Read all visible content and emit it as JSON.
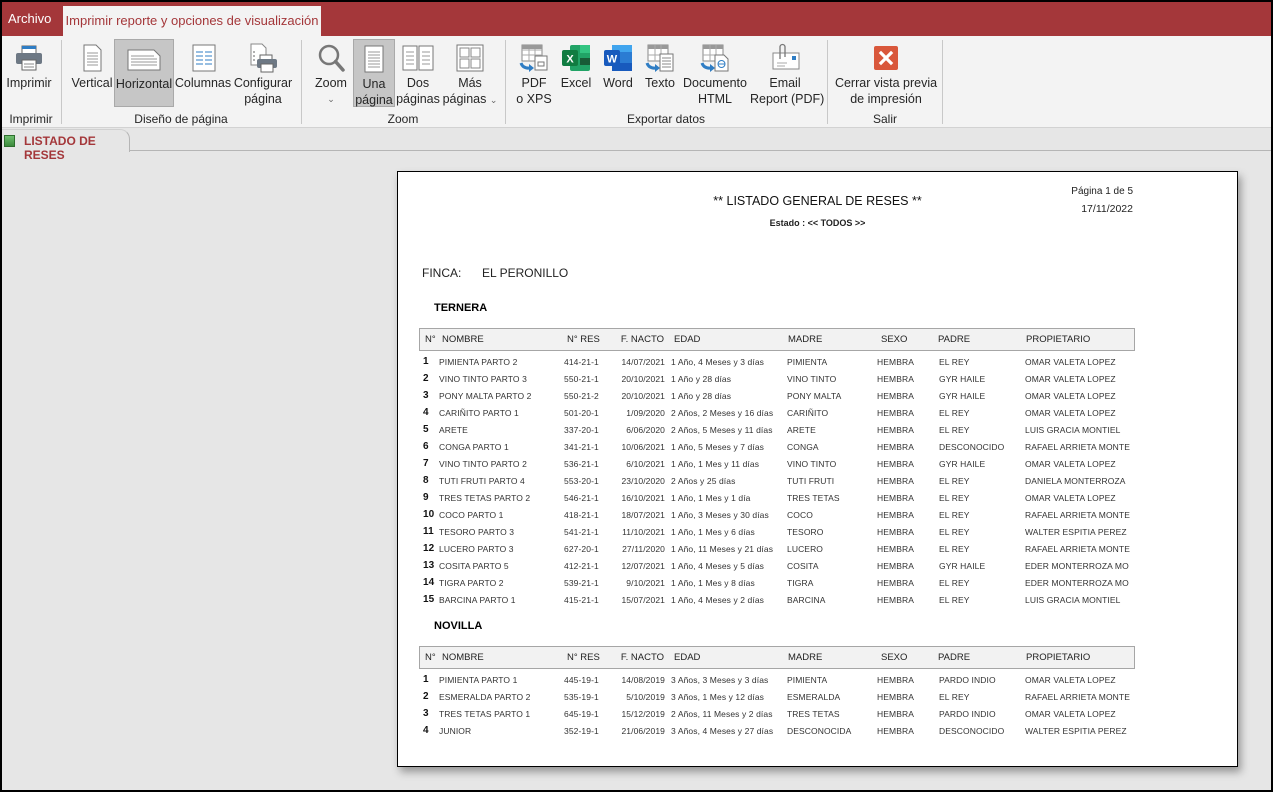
{
  "tabs": {
    "file": "Archivo",
    "active": "Imprimir reporte y opciones de visualización"
  },
  "ribbon": {
    "groups": {
      "imprimir": "Imprimir",
      "diseno": "Diseño de página",
      "zoom": "Zoom",
      "exportar": "Exportar datos",
      "salir": "Salir"
    },
    "buttons": {
      "imprimir": "Imprimir",
      "vertical": "Vertical",
      "horizontal": "Horizontal",
      "columnas": "Columnas",
      "configurar_1": "Configurar",
      "configurar_2": "página",
      "zoom": "Zoom",
      "una_1": "Una",
      "una_2": "página",
      "dos_1": "Dos",
      "dos_2": "páginas",
      "mas_1": "Más",
      "mas_2": "páginas",
      "pdf_1": "PDF",
      "pdf_2": "o XPS",
      "excel": "Excel",
      "word": "Word",
      "texto": "Texto",
      "html_1": "Documento",
      "html_2": "HTML",
      "email_1": "Email",
      "email_2": "Report (PDF)",
      "cerrar_1": "Cerrar vista previa",
      "cerrar_2": "de impresión"
    },
    "selected": [
      "horizontal",
      "una_pagina"
    ]
  },
  "document_tab": "LISTADO DE RESES",
  "report": {
    "title": "** LISTADO GENERAL DE RESES **",
    "estado": "Estado : << TODOS >>",
    "page_info": "Página 1 de 5",
    "date": "17/11/2022",
    "finca_label": "FINCA:",
    "finca_value": "EL PERONILLO",
    "columns": [
      "N°",
      "NOMBRE",
      "N° RES",
      "F. NACTO",
      "EDAD",
      "MADRE",
      "SEXO",
      "PADRE",
      "PROPIETARIO"
    ],
    "sections": [
      {
        "name": "TERNERA",
        "rows": [
          [
            "1",
            "PIMIENTA PARTO 2",
            "414-21-1",
            "14/07/2021",
            "1 Año, 4 Meses y 3 días",
            "PIMIENTA",
            "HEMBRA",
            "EL  REY",
            "OMAR VALETA LOPEZ"
          ],
          [
            "2",
            "VINO TINTO PARTO 3",
            "550-21-1",
            "20/10/2021",
            "1 Año y 28 días",
            "VINO TINTO",
            "HEMBRA",
            "GYR HAILE",
            "OMAR VALETA LOPEZ"
          ],
          [
            "3",
            "PONY MALTA PARTO 2",
            "550-21-2",
            "20/10/2021",
            "1 Año y 28 días",
            "PONY MALTA",
            "HEMBRA",
            "GYR HAILE",
            "OMAR VALETA LOPEZ"
          ],
          [
            "4",
            "CARIÑITO PARTO 1",
            "501-20-1",
            "1/09/2020",
            "2 Años, 2 Meses y 16 días",
            "CARIÑITO",
            "HEMBRA",
            "EL  REY",
            "OMAR VALETA LOPEZ"
          ],
          [
            "5",
            "ARETE",
            "337-20-1",
            "6/06/2020",
            "2 Años, 5 Meses y 11 días",
            "ARETE",
            "HEMBRA",
            "EL REY",
            "LUIS GRACIA MONTIEL"
          ],
          [
            "6",
            "CONGA PARTO 1",
            "341-21-1",
            "10/06/2021",
            "1 Año, 5 Meses y 7 días",
            "CONGA",
            "HEMBRA",
            "DESCONOCIDO",
            "RAFAEL ARRIETA MONTE"
          ],
          [
            "7",
            "VINO TINTO PARTO 2",
            "536-21-1",
            "6/10/2021",
            "1 Año, 1 Mes y 11 días",
            "VINO TINTO",
            "HEMBRA",
            "GYR HAILE",
            "OMAR VALETA LOPEZ"
          ],
          [
            "8",
            "TUTI FRUTI PARTO 4",
            "553-20-1",
            "23/10/2020",
            "2 Años y 25 días",
            "TUTI FRUTI",
            "HEMBRA",
            "EL  REY",
            "DANIELA MONTERROZA"
          ],
          [
            "9",
            "TRES TETAS PARTO 2",
            "546-21-1",
            "16/10/2021",
            "1 Año, 1 Mes y 1 día",
            "TRES TETAS",
            "HEMBRA",
            "EL  REY",
            "OMAR VALETA LOPEZ"
          ],
          [
            "10",
            "COCO PARTO 1",
            "418-21-1",
            "18/07/2021",
            "1 Año, 3 Meses y 30 días",
            "COCO",
            "HEMBRA",
            "EL  REY",
            "RAFAEL ARRIETA MONTE"
          ],
          [
            "11",
            "TESORO PARTO 3",
            "541-21-1",
            "11/10/2021",
            "1 Año, 1 Mes y 6 días",
            "TESORO",
            "HEMBRA",
            "EL  REY",
            "WALTER ESPITIA PEREZ"
          ],
          [
            "12",
            "LUCERO PARTO 3",
            "627-20-1",
            "27/11/2020",
            "1 Año, 11 Meses y 21 días",
            "LUCERO",
            "HEMBRA",
            "EL  REY",
            "RAFAEL ARRIETA MONTE"
          ],
          [
            "13",
            "COSITA PARTO 5",
            "412-21-1",
            "12/07/2021",
            "1 Año, 4 Meses y 5 días",
            "COSITA",
            "HEMBRA",
            "GYR HAILE",
            "EDER MONTERROZA MO"
          ],
          [
            "14",
            "TIGRA PARTO 2",
            "539-21-1",
            "9/10/2021",
            "1 Año, 1 Mes y 8 días",
            "TIGRA",
            "HEMBRA",
            "EL  REY",
            "EDER MONTERROZA MO"
          ],
          [
            "15",
            "BARCINA PARTO 1",
            "415-21-1",
            "15/07/2021",
            "1 Año, 4 Meses y 2 días",
            "BARCINA",
            "HEMBRA",
            "EL  REY",
            "LUIS GRACIA MONTIEL"
          ]
        ]
      },
      {
        "name": "NOVILLA",
        "rows": [
          [
            "1",
            "PIMIENTA PARTO 1",
            "445-19-1",
            "14/08/2019",
            "3 Años, 3 Meses y 3 días",
            "PIMIENTA",
            "HEMBRA",
            "PARDO INDIO",
            "OMAR VALETA LOPEZ"
          ],
          [
            "2",
            "ESMERALDA PARTO 2",
            "535-19-1",
            "5/10/2019",
            "3 Años, 1 Mes y 12 días",
            "ESMERALDA",
            "HEMBRA",
            "EL  REY",
            "RAFAEL ARRIETA MONTE"
          ],
          [
            "3",
            "TRES TETAS PARTO 1",
            "645-19-1",
            "15/12/2019",
            "2 Años, 11 Meses y 2 días",
            "TRES TETAS",
            "HEMBRA",
            "PARDO INDIO",
            "OMAR VALETA LOPEZ"
          ],
          [
            "4",
            "JUNIOR",
            "352-19-1",
            "21/06/2019",
            "3 Años, 4 Meses y 27 días",
            "DESCONOCIDA",
            "HEMBRA",
            "DESCONOCIDO",
            "WALTER ESPITIA PEREZ"
          ]
        ]
      }
    ]
  },
  "colors": {
    "brand": "#a4373a",
    "ribbon_bg": "#f3f3f3",
    "workspace_bg": "#e6e6e6",
    "selected_btn": "#c6c6c6"
  }
}
